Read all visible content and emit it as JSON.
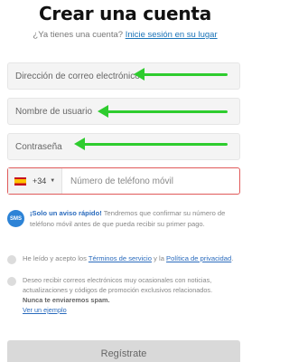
{
  "header": {
    "title": "Crear una cuenta",
    "has_account_text": "¿Ya tienes una cuenta?",
    "login_link": "Inicie sesión en su lugar"
  },
  "form": {
    "email_placeholder": "Dirección de correo electrónico",
    "username_placeholder": "Nombre de usuario",
    "password_placeholder": "Contraseña",
    "phone": {
      "country_flag": "spain-flag-icon",
      "dial_code": "+34",
      "placeholder": "Número de teléfono móvil"
    }
  },
  "sms_notice": {
    "icon": "SMS",
    "lead": "¡Solo un aviso rápido!",
    "text": "Tendremos que confirmar su número de teléfono móvil antes de que pueda recibir su primer pago."
  },
  "terms": {
    "prefix": "He leído y acepto los",
    "terms_link": "Términos de servicio",
    "and": "y la",
    "privacy_link": "Política de privacidad",
    "suffix": "."
  },
  "marketing": {
    "text": "Deseo recibir correos electrónicos muy ocasionales con noticias, actualizaciones y códigos de promoción exclusivos relacionados.",
    "bold": "Nunca te enviaremos spam.",
    "example_link": "Ver un ejemplo"
  },
  "submit_label": "Regístrate",
  "colors": {
    "accent_link": "#1a73b8",
    "error_border": "#e05a5a",
    "arrow_green": "#2ecc2e",
    "sms_icon": "#2d83d6"
  }
}
